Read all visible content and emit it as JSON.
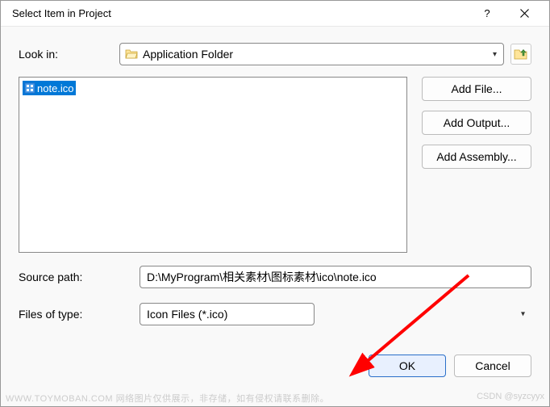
{
  "title": "Select Item in Project",
  "labels": {
    "look_in": "Look in:",
    "source_path": "Source path:",
    "files_of_type": "Files of type:"
  },
  "lookin": {
    "selected": "Application Folder"
  },
  "files": {
    "items": [
      {
        "name": "note.ico",
        "selected": true
      }
    ]
  },
  "side_buttons": {
    "add_file": "Add File...",
    "add_output": "Add Output...",
    "add_assembly": "Add Assembly..."
  },
  "source_path": "D:\\MyProgram\\相关素材\\图标素材\\ico\\note.ico",
  "files_of_type": "Icon Files (*.ico)",
  "footer": {
    "ok": "OK",
    "cancel": "Cancel"
  },
  "watermark": {
    "left": "WWW.TOYMOBAN.COM  网络图片仅供展示，非存储，如有侵权请联系删除。",
    "right": "CSDN @syzcyyx"
  }
}
